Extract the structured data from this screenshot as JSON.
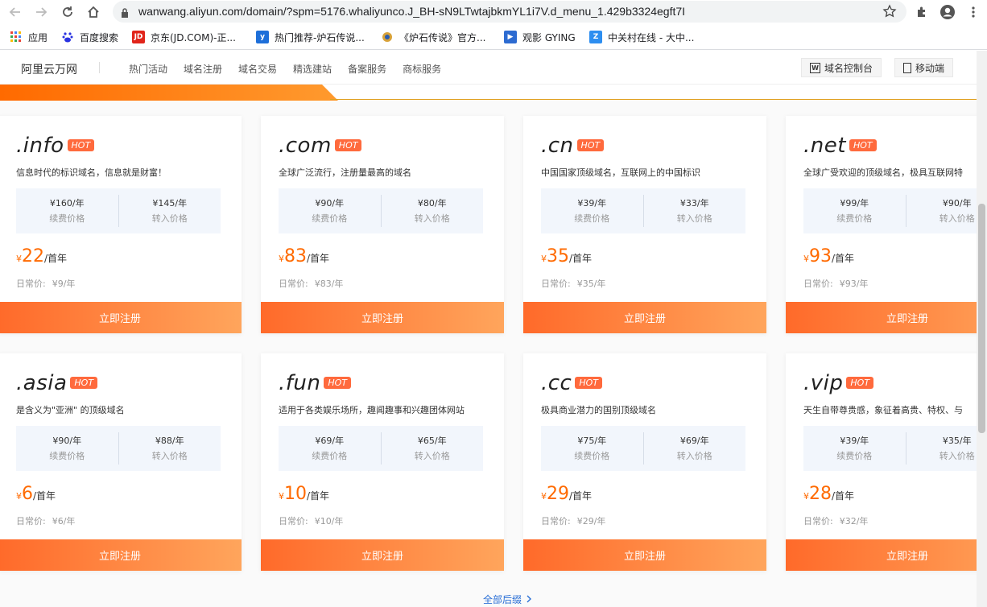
{
  "browser": {
    "url": "wanwang.aliyun.com/domain/?spm=5176.whaliyunco.J_BH-sN9LTwtajbkmYL1i7V.d_menu_1.429b3324egft7I",
    "bookmarks": [
      {
        "label": "应用",
        "icon": "apps-grid-icon",
        "color": "#4285f4"
      },
      {
        "label": "百度搜索",
        "icon": "baidu-icon",
        "color": "#2932e1"
      },
      {
        "label": "京东(JD.COM)-正...",
        "icon": "jd-icon",
        "color": "#e1251b"
      },
      {
        "label": "热门推荐-炉石传说...",
        "icon": "hearthstone-icon",
        "color": "#1e6fd9"
      },
      {
        "label": "《炉石传说》官方...",
        "icon": "hearthstone-icon",
        "color": "#d8a23a"
      },
      {
        "label": "观影 GYING",
        "icon": "play-icon",
        "color": "#2d6bd1"
      },
      {
        "label": "中关村在线 - 大中...",
        "icon": "zol-icon",
        "color": "#2d8ef0"
      }
    ]
  },
  "header": {
    "logo": "阿里云万网",
    "nav": [
      "热门活动",
      "域名注册",
      "域名交易",
      "精选建站",
      "备案服务",
      "商标服务"
    ],
    "console_label": "域名控制台",
    "mobile_label": "移动端"
  },
  "common": {
    "hot": "HOT",
    "renew_label": "续费价格",
    "transfer_label": "转入价格",
    "currency": "¥",
    "per_first_year": "/首年",
    "regular_label": "日常价:",
    "register_button": "立即注册"
  },
  "cards": [
    {
      "tld": ".info",
      "desc": "信息时代的标识域名，信息就是财富！",
      "renew": "¥160/年",
      "transfer": "¥145/年",
      "price": "22",
      "regular": "¥9/年"
    },
    {
      "tld": ".com",
      "desc": "全球广泛流行，注册量最高的域名",
      "renew": "¥90/年",
      "transfer": "¥80/年",
      "price": "83",
      "regular": "¥83/年"
    },
    {
      "tld": ".cn",
      "desc": "中国国家顶级域名，互联网上的中国标识",
      "renew": "¥39/年",
      "transfer": "¥33/年",
      "price": "35",
      "regular": "¥35/年"
    },
    {
      "tld": ".net",
      "desc": "全球广受欢迎的顶级域名，极具互联网特",
      "renew": "¥99/年",
      "transfer": "¥90/年",
      "price": "93",
      "regular": "¥93/年"
    },
    {
      "tld": ".asia",
      "desc": "是含义为\"亚洲\" 的顶级域名",
      "renew": "¥90/年",
      "transfer": "¥88/年",
      "price": "6",
      "regular": "¥6/年"
    },
    {
      "tld": ".fun",
      "desc": "适用于各类娱乐场所，趣闻趣事和兴趣团体网站",
      "renew": "¥69/年",
      "transfer": "¥65/年",
      "price": "10",
      "regular": "¥10/年"
    },
    {
      "tld": ".cc",
      "desc": "极具商业潜力的国别顶级域名",
      "renew": "¥75/年",
      "transfer": "¥69/年",
      "price": "29",
      "regular": "¥29/年"
    },
    {
      "tld": ".vip",
      "desc": "天生自带尊贵感，象征着高贵、特权、与",
      "renew": "¥39/年",
      "transfer": "¥35/年",
      "price": "28",
      "regular": "¥32/年"
    }
  ],
  "more_label": "全部后缀",
  "colors": {
    "accent": "#ff6a00",
    "hot_badge": "#ff6a3d",
    "link": "#2a6fd6"
  }
}
